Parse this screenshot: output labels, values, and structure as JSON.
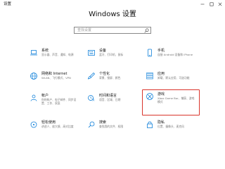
{
  "window": {
    "title": "设置"
  },
  "page": {
    "heading": "Windows 设置"
  },
  "search": {
    "placeholder": "查找设置"
  },
  "tiles": [
    {
      "title": "系统",
      "desc": "显示器、声音、通知、电源",
      "icon": "laptop-icon"
    },
    {
      "title": "设备",
      "desc": "蓝牙、打印机、鼠标",
      "icon": "keyboard-icon"
    },
    {
      "title": "手机",
      "desc": "连接 Android 设备和 iPhone",
      "icon": "phone-icon"
    },
    {
      "title": "网络和 Internet",
      "desc": "WLAN、飞行模式、VPN",
      "icon": "globe-icon"
    },
    {
      "title": "个性化",
      "desc": "背景、锁屏、颜色",
      "icon": "brush-icon"
    },
    {
      "title": "应用",
      "desc": "卸载、默认应用、可选功能",
      "icon": "apps-icon"
    },
    {
      "title": "帐户",
      "desc": "你的帐户、电子邮件、同步设置、工作、家庭",
      "icon": "person-icon"
    },
    {
      "title": "时间和语言",
      "desc": "语音、区域、日期",
      "icon": "time-language-icon"
    },
    {
      "title": "游戏",
      "desc": "Xbox Game Bar、捕获、游戏模式",
      "icon": "xbox-icon",
      "highlighted": true
    },
    {
      "title": "轻松使用",
      "desc": "讲述人、放大镜、高对比度",
      "icon": "ease-of-access-icon"
    },
    {
      "title": "搜索",
      "desc": "查找我的文件、权限",
      "icon": "search-icon"
    },
    {
      "title": "隐私",
      "desc": "位置、摄像头、麦克风",
      "icon": "lock-icon"
    }
  ],
  "colors": {
    "accent": "#0078d7",
    "highlight": "#d9342b"
  }
}
